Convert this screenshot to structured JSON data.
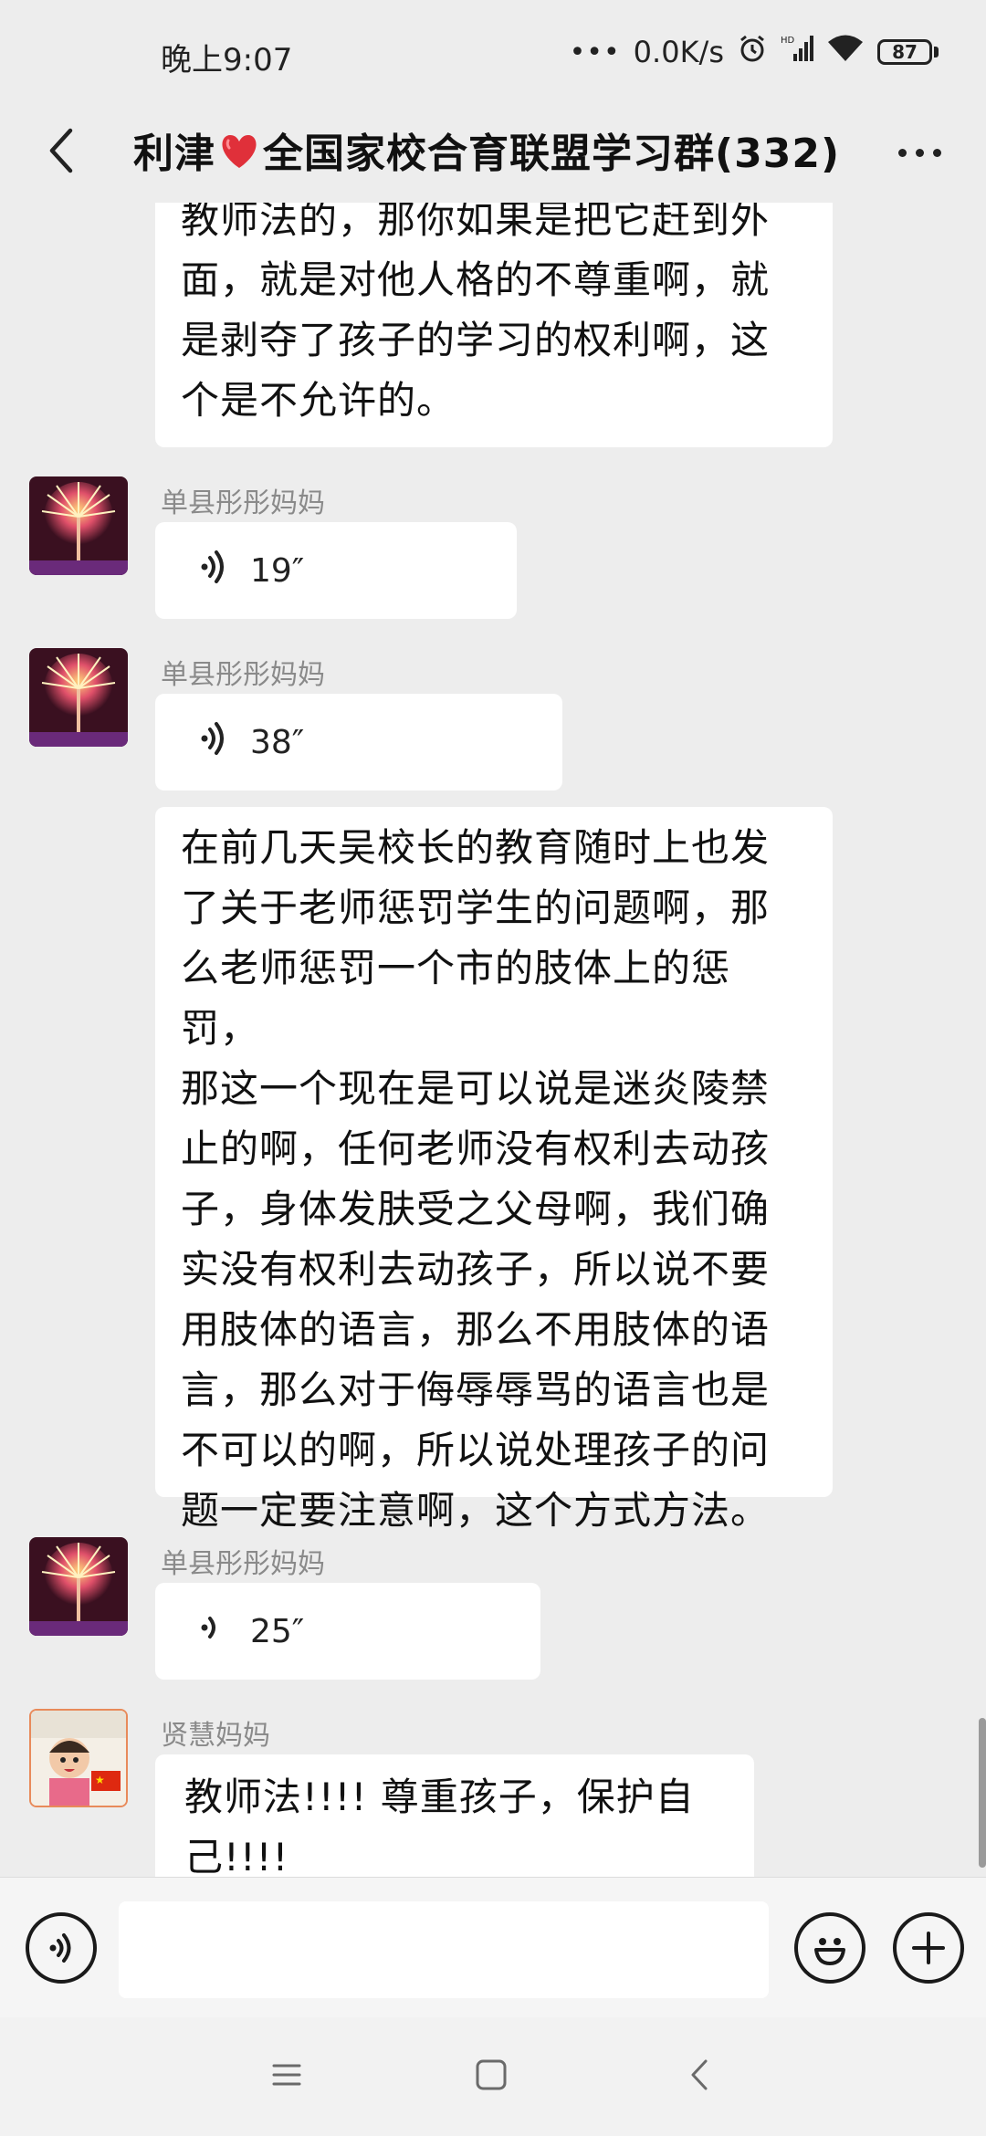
{
  "status_bar": {
    "time": "晚上9:07",
    "net_speed": "0.0K/s",
    "battery": "87"
  },
  "header": {
    "title_prefix": "利津",
    "title_suffix": "全国家校合育联盟学习群(332)"
  },
  "messages": [
    {
      "type": "text",
      "lines": [
        "教师法的，那你如果是把它赶到外",
        "面，就是对他人格的不尊重啊，就",
        "是剥夺了孩子的学习的权利啊，这",
        "个是不允许的。"
      ]
    },
    {
      "type": "voice",
      "sender": "单县彤彤妈妈",
      "duration": "19″"
    },
    {
      "type": "voice",
      "sender": "单县彤彤妈妈",
      "duration": "38″"
    },
    {
      "type": "text",
      "lines": [
        "在前几天吴校长的教育随时上也发",
        "了关于老师惩罚学生的问题啊，那",
        "么老师惩罚一个市的肢体上的惩罚，",
        "那这一个现在是可以说是迷炎陵禁",
        "止的啊，任何老师没有权利去动孩",
        "子，身体发肤受之父母啊，我们确",
        "实没有权利去动孩子，所以说不要",
        "用肢体的语言，那么不用肢体的语",
        "言，那么对于侮辱辱骂的语言也是",
        "不可以的啊，所以说处理孩子的问",
        "题一定要注意啊，这个方式方法。"
      ]
    },
    {
      "type": "voice",
      "sender": "单县彤彤妈妈",
      "duration": "25″"
    },
    {
      "type": "text",
      "sender": "贤慧妈妈",
      "lines": [
        "教师法!!!! 尊重孩子，保护自",
        "己!!!!"
      ]
    }
  ],
  "icons": {
    "back": "chevron-left-icon",
    "more": "more-dots-icon",
    "voice_toggle": "voice-input-icon",
    "emoji": "emoji-icon",
    "plus": "plus-icon",
    "nav_menu": "menu-icon",
    "nav_home": "home-icon",
    "nav_back": "back-icon"
  }
}
